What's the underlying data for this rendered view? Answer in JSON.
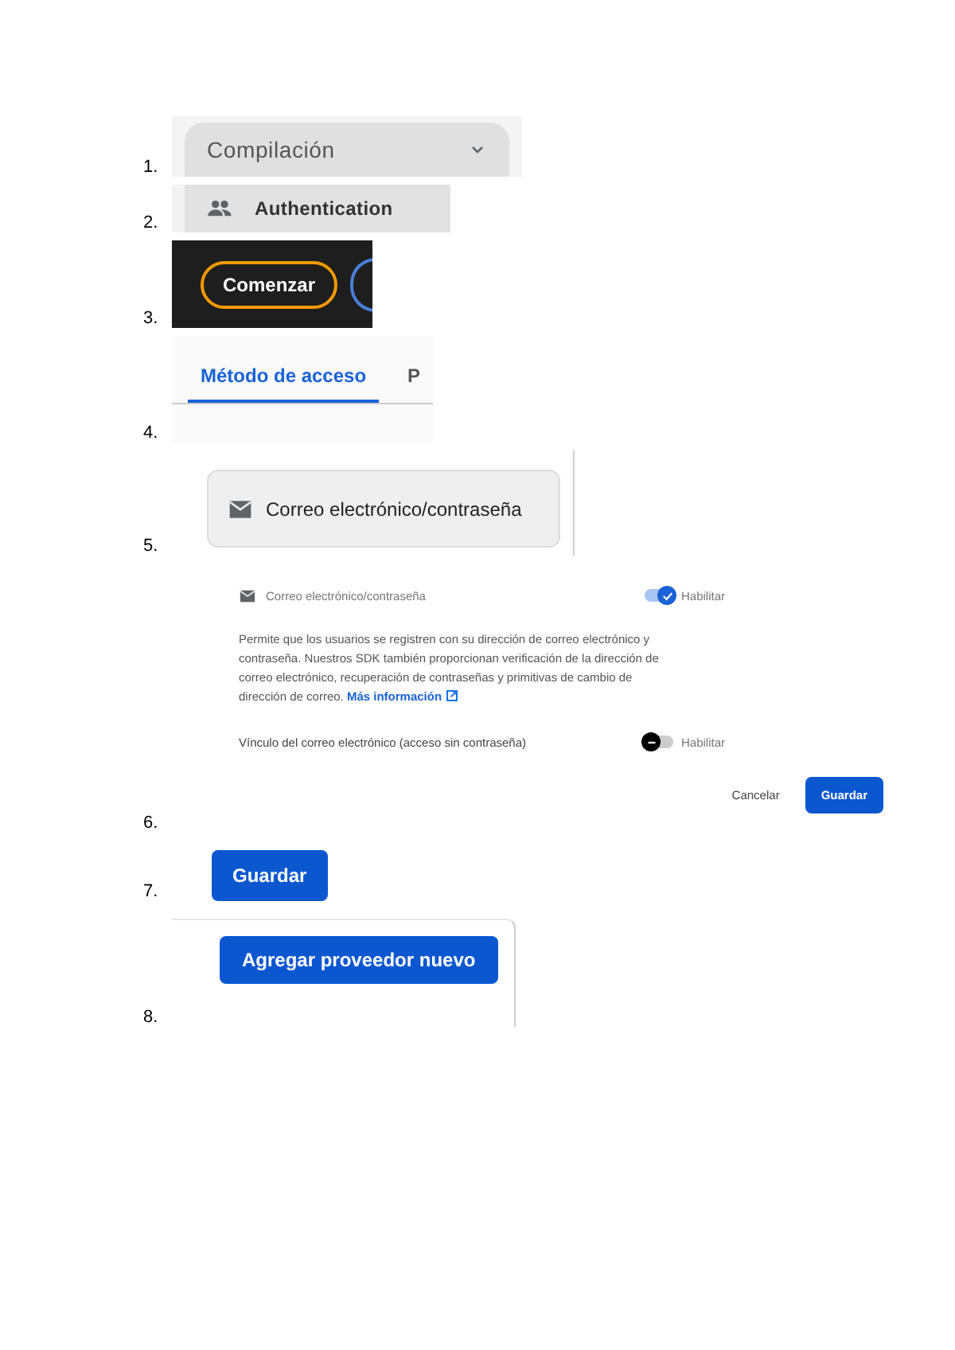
{
  "steps": [
    {
      "number": "1.",
      "kind": "dropdown",
      "label": "Compilación"
    },
    {
      "number": "2.",
      "kind": "nav-item",
      "label": "Authentication"
    },
    {
      "number": "3.",
      "kind": "dark-button",
      "label": "Comenzar"
    },
    {
      "number": "4.",
      "kind": "tabs",
      "tabs": [
        {
          "label": "Método de acceso",
          "selected": true
        },
        {
          "label": "P",
          "selected": false
        }
      ]
    },
    {
      "number": "5.",
      "kind": "provider",
      "label": "Correo electrónico/contraseña"
    },
    {
      "number": "6.",
      "kind": "settings",
      "provider": "Correo electrónico/contraseña",
      "toggle_label": "Habilitar",
      "on": true,
      "description": "Permite que los usuarios se registren con su dirección de correo electrónico y contraseña. Nuestros SDK también proporcionan verificación de la dirección de correo electrónico, recuperación de contraseñas y primitivas de cambio de dirección de correo.",
      "link": "Más información",
      "option": {
        "label": "Vínculo del correo electrónico (acceso sin contraseña)",
        "toggle_label": "Habilitar",
        "on": false
      },
      "cancel": "Cancelar",
      "save": "Guardar"
    },
    {
      "number": "7.",
      "kind": "button",
      "label": "Guardar"
    },
    {
      "number": "8.",
      "kind": "button-panel",
      "label": "Agregar proveedor nuevo"
    }
  ]
}
